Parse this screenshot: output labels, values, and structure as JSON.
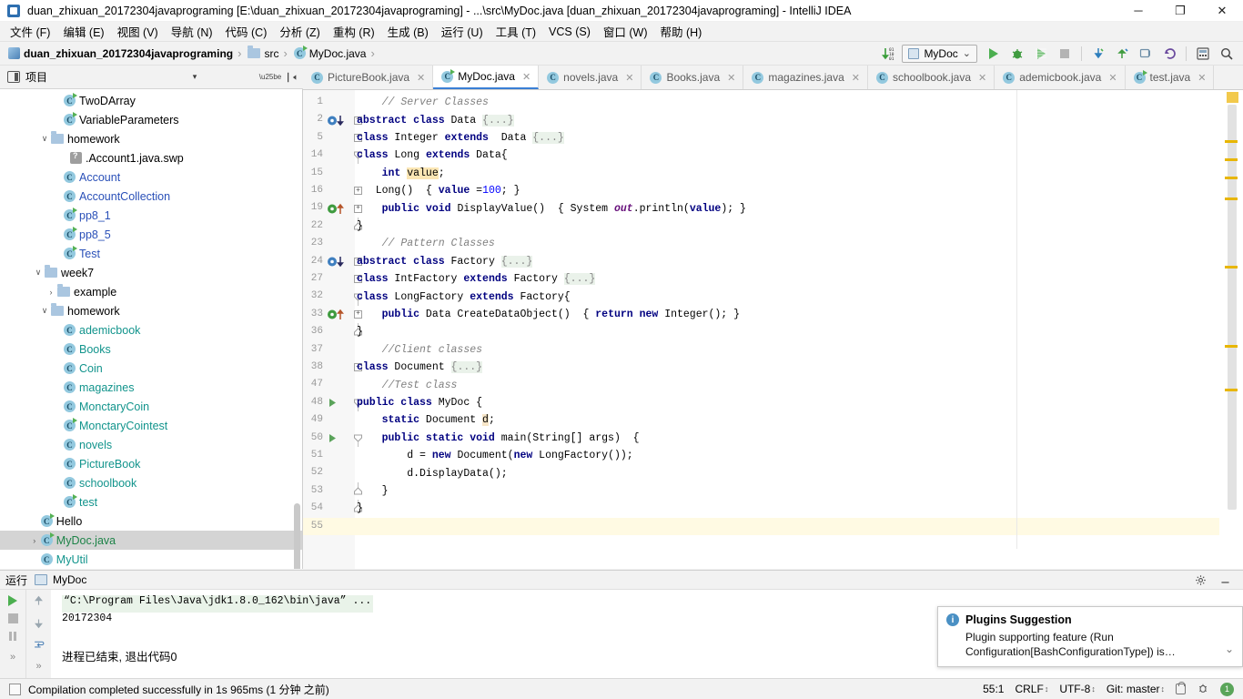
{
  "window": {
    "title": "duan_zhixuan_20172304javaprograming [E:\\duan_zhixuan_20172304javaprograming] - ...\\src\\MyDoc.java [duan_zhixuan_20172304javaprograming] - IntelliJ IDEA",
    "minimize": "─",
    "maximize": "❐",
    "close": "✕"
  },
  "menubar": {
    "items": [
      {
        "label": "文件 (F)"
      },
      {
        "label": "编辑 (E)"
      },
      {
        "label": "视图 (V)"
      },
      {
        "label": "导航 (N)"
      },
      {
        "label": "代码 (C)"
      },
      {
        "label": "分析 (Z)"
      },
      {
        "label": "重构 (R)"
      },
      {
        "label": "生成 (B)"
      },
      {
        "label": "运行 (U)"
      },
      {
        "label": "工具 (T)"
      },
      {
        "label": "VCS (S)"
      },
      {
        "label": "窗口 (W)"
      },
      {
        "label": "帮助 (H)"
      }
    ]
  },
  "breadcrumb": {
    "items": [
      {
        "label": "duan_zhixuan_20172304javaprograming",
        "icon": "module-icon",
        "bold": true
      },
      {
        "label": "src",
        "icon": "folder-icon",
        "bold": false
      },
      {
        "label": "MyDoc.java",
        "icon": "java-class-icon",
        "bold": false
      }
    ],
    "separator": "›"
  },
  "toolbar": {
    "sort_icon": "sort-numeric-icon",
    "run_config": "MyDoc",
    "run_config_caret": "⌄",
    "run_button": "run-button",
    "debug_button": "debug-button",
    "coverage_button": "run-with-coverage-button",
    "stop_button": "stop-button",
    "update_button": "vcs-update-button",
    "commit_button": "vcs-commit-button",
    "history_button": "vcs-history-button",
    "rollback_button": "vcs-rollback-button",
    "layout_button": "layout-button",
    "search_button": "search-everywhere-button"
  },
  "project_panel": {
    "title": "项目",
    "collapse_caret": "▾",
    "settings_icon": "gear-icon",
    "collapse_all_icon": "collapse-all-icon",
    "tree": [
      {
        "label": "TwoDArray",
        "indent": 4,
        "arrow": "",
        "icon": "java-class-runnable-icon",
        "color": "dark"
      },
      {
        "label": "VariableParameters",
        "indent": 4,
        "arrow": "",
        "icon": "java-class-runnable-icon",
        "color": "dark"
      },
      {
        "label": "homework",
        "indent": 3,
        "arrow": "∨",
        "icon": "folder-icon",
        "color": "dark"
      },
      {
        "label": ".Account1.java.swp",
        "indent": 4.5,
        "arrow": "",
        "icon": "unknown-file-icon",
        "color": "dark"
      },
      {
        "label": "Account",
        "indent": 4,
        "arrow": "",
        "icon": "java-class-icon",
        "color": "blue"
      },
      {
        "label": "AccountCollection",
        "indent": 4,
        "arrow": "",
        "icon": "java-class-icon",
        "color": "blue"
      },
      {
        "label": "pp8_1",
        "indent": 4,
        "arrow": "",
        "icon": "java-class-runnable-icon",
        "color": "blue"
      },
      {
        "label": "pp8_5",
        "indent": 4,
        "arrow": "",
        "icon": "java-class-runnable-icon",
        "color": "blue"
      },
      {
        "label": "Test",
        "indent": 4,
        "arrow": "",
        "icon": "java-class-runnable-icon",
        "color": "blue"
      },
      {
        "label": "week7",
        "indent": 2.5,
        "arrow": "∨",
        "icon": "folder-icon",
        "color": "dark"
      },
      {
        "label": "example",
        "indent": 3.5,
        "arrow": "›",
        "icon": "folder-icon",
        "color": "dark"
      },
      {
        "label": "homework",
        "indent": 3,
        "arrow": "∨",
        "icon": "folder-icon",
        "color": "dark"
      },
      {
        "label": "ademicbook",
        "indent": 4,
        "arrow": "",
        "icon": "java-class-icon",
        "color": "teal"
      },
      {
        "label": "Books",
        "indent": 4,
        "arrow": "",
        "icon": "java-class-icon",
        "color": "teal"
      },
      {
        "label": "Coin",
        "indent": 4,
        "arrow": "",
        "icon": "java-class-icon",
        "color": "teal"
      },
      {
        "label": "magazines",
        "indent": 4,
        "arrow": "",
        "icon": "java-class-icon",
        "color": "teal"
      },
      {
        "label": "MonctaryCoin",
        "indent": 4,
        "arrow": "",
        "icon": "java-class-icon",
        "color": "teal"
      },
      {
        "label": "MonctaryCointest",
        "indent": 4,
        "arrow": "",
        "icon": "java-class-runnable-icon",
        "color": "teal"
      },
      {
        "label": "novels",
        "indent": 4,
        "arrow": "",
        "icon": "java-class-icon",
        "color": "teal"
      },
      {
        "label": "PictureBook",
        "indent": 4,
        "arrow": "",
        "icon": "java-class-icon",
        "color": "teal"
      },
      {
        "label": "schoolbook",
        "indent": 4,
        "arrow": "",
        "icon": "java-class-icon",
        "color": "teal"
      },
      {
        "label": "test",
        "indent": 4,
        "arrow": "",
        "icon": "java-class-runnable-icon",
        "color": "teal"
      },
      {
        "label": "Hello",
        "indent": 2.2,
        "arrow": "",
        "icon": "java-class-runnable-icon",
        "color": "dark"
      },
      {
        "label": "MyDoc.java",
        "indent": 2.2,
        "arrow": "›",
        "icon": "java-class-runnable-icon",
        "color": "green",
        "selected": true
      },
      {
        "label": "MyUtil",
        "indent": 2.2,
        "arrow": "",
        "icon": "java-class-icon",
        "color": "teal"
      }
    ]
  },
  "editor_tabs": [
    {
      "label": "PictureBook.java",
      "active": false,
      "modified": false
    },
    {
      "label": "MyDoc.java",
      "active": true,
      "modified": true
    },
    {
      "label": "novels.java",
      "active": false,
      "modified": false
    },
    {
      "label": "Books.java",
      "active": false,
      "modified": false
    },
    {
      "label": "magazines.java",
      "active": false,
      "modified": false
    },
    {
      "label": "schoolbook.java",
      "active": false,
      "modified": false
    },
    {
      "label": "ademicbook.java",
      "active": false,
      "modified": false
    },
    {
      "label": "test.java",
      "active": false,
      "modified": true
    }
  ],
  "editor": {
    "lines": [
      {
        "num": "1",
        "gutter": "",
        "fold": "",
        "tokens": [
          {
            "t": "    ",
            "c": "id"
          },
          {
            "t": "// Server Classes",
            "c": "cm"
          }
        ]
      },
      {
        "num": "2",
        "gutter": "override-down",
        "fold": "plus",
        "tokens": [
          {
            "t": "abstract class ",
            "c": "kw"
          },
          {
            "t": "Data ",
            "c": "id"
          },
          {
            "t": "{...}",
            "c": "fldfold"
          }
        ]
      },
      {
        "num": "5",
        "gutter": "",
        "fold": "plus",
        "tokens": [
          {
            "t": "class ",
            "c": "kw"
          },
          {
            "t": "Integer ",
            "c": "id"
          },
          {
            "t": "extends ",
            "c": "kw"
          },
          {
            "t": " Data ",
            "c": "id"
          },
          {
            "t": "{...}",
            "c": "fldfold"
          }
        ]
      },
      {
        "num": "14",
        "gutter": "",
        "fold": "minus-top",
        "tokens": [
          {
            "t": "class ",
            "c": "kw"
          },
          {
            "t": "Long ",
            "c": "id"
          },
          {
            "t": "extends ",
            "c": "kw"
          },
          {
            "t": "Data{",
            "c": "id"
          }
        ]
      },
      {
        "num": "15",
        "gutter": "",
        "fold": "",
        "tokens": [
          {
            "t": "    ",
            "c": "id"
          },
          {
            "t": "int ",
            "c": "kw"
          },
          {
            "t": "value",
            "c": "hl"
          },
          {
            "t": ";",
            "c": "id"
          }
        ]
      },
      {
        "num": "16",
        "gutter": "",
        "fold": "plus",
        "tokens": [
          {
            "t": "   Long",
            "c": "id"
          },
          {
            "t": "()  { ",
            "c": "id"
          },
          {
            "t": "value ",
            "c": "kw"
          },
          {
            "t": "=",
            "c": "id"
          },
          {
            "t": "100",
            "c": "num"
          },
          {
            "t": "; }",
            "c": "id"
          }
        ]
      },
      {
        "num": "19",
        "gutter": "implement-up",
        "fold": "plus",
        "tokens": [
          {
            "t": "    ",
            "c": "id"
          },
          {
            "t": "public void ",
            "c": "kw"
          },
          {
            "t": "DisplayValue()  { System ",
            "c": "id"
          },
          {
            "t": "out",
            "c": "stat"
          },
          {
            "t": ".println(",
            "c": "id"
          },
          {
            "t": "value",
            "c": "kw"
          },
          {
            "t": "); }",
            "c": "id"
          }
        ]
      },
      {
        "num": "22",
        "gutter": "",
        "fold": "minus-bot",
        "tokens": [
          {
            "t": "}",
            "c": "id"
          }
        ]
      },
      {
        "num": "23",
        "gutter": "",
        "fold": "",
        "tokens": [
          {
            "t": "    ",
            "c": "id"
          },
          {
            "t": "// Pattern Classes",
            "c": "cm"
          }
        ]
      },
      {
        "num": "24",
        "gutter": "override-down",
        "fold": "plus",
        "tokens": [
          {
            "t": "abstract class ",
            "c": "kw"
          },
          {
            "t": "Factory ",
            "c": "id"
          },
          {
            "t": "{...}",
            "c": "fldfold"
          }
        ]
      },
      {
        "num": "27",
        "gutter": "",
        "fold": "plus",
        "tokens": [
          {
            "t": "class ",
            "c": "kw"
          },
          {
            "t": "IntFactory ",
            "c": "id"
          },
          {
            "t": "extends ",
            "c": "kw"
          },
          {
            "t": "Factory ",
            "c": "id"
          },
          {
            "t": "{...}",
            "c": "fldfold"
          }
        ]
      },
      {
        "num": "32",
        "gutter": "",
        "fold": "minus-top",
        "tokens": [
          {
            "t": "class ",
            "c": "kw"
          },
          {
            "t": "LongFactory ",
            "c": "id"
          },
          {
            "t": "extends ",
            "c": "kw"
          },
          {
            "t": "Factory{",
            "c": "id"
          }
        ]
      },
      {
        "num": "33",
        "gutter": "implement-up",
        "fold": "plus",
        "tokens": [
          {
            "t": "    ",
            "c": "id"
          },
          {
            "t": "public ",
            "c": "kw"
          },
          {
            "t": "Data CreateDataObject()  { ",
            "c": "id"
          },
          {
            "t": "return new ",
            "c": "kw"
          },
          {
            "t": "Integer(); }",
            "c": "id"
          }
        ]
      },
      {
        "num": "36",
        "gutter": "",
        "fold": "minus-bot",
        "tokens": [
          {
            "t": "}",
            "c": "id"
          }
        ]
      },
      {
        "num": "37",
        "gutter": "",
        "fold": "",
        "tokens": [
          {
            "t": "    ",
            "c": "id"
          },
          {
            "t": "//Client classes",
            "c": "cm"
          }
        ]
      },
      {
        "num": "38",
        "gutter": "",
        "fold": "plus",
        "tokens": [
          {
            "t": "class ",
            "c": "kw"
          },
          {
            "t": "Document ",
            "c": "id"
          },
          {
            "t": "{...}",
            "c": "fldfold"
          }
        ]
      },
      {
        "num": "47",
        "gutter": "",
        "fold": "",
        "tokens": [
          {
            "t": "    ",
            "c": "id"
          },
          {
            "t": "//Test class",
            "c": "cm"
          }
        ]
      },
      {
        "num": "48",
        "gutter": "run-triangle",
        "fold": "minus-top",
        "tokens": [
          {
            "t": "public class ",
            "c": "kw"
          },
          {
            "t": "MyDoc {",
            "c": "id"
          }
        ]
      },
      {
        "num": "49",
        "gutter": "",
        "fold": "",
        "tokens": [
          {
            "t": "    ",
            "c": "id"
          },
          {
            "t": "static ",
            "c": "kw"
          },
          {
            "t": "Document ",
            "c": "id"
          },
          {
            "t": "d",
            "c": "fieldhl"
          },
          {
            "t": ";",
            "c": "id"
          }
        ]
      },
      {
        "num": "50",
        "gutter": "run-triangle",
        "fold": "minus-top",
        "tokens": [
          {
            "t": "    ",
            "c": "id"
          },
          {
            "t": "public static void ",
            "c": "kw"
          },
          {
            "t": "main(String[] args)  {",
            "c": "id"
          }
        ]
      },
      {
        "num": "51",
        "gutter": "",
        "fold": "",
        "tokens": [
          {
            "t": "        d = ",
            "c": "id"
          },
          {
            "t": "new ",
            "c": "kw"
          },
          {
            "t": "Document(",
            "c": "id"
          },
          {
            "t": "new ",
            "c": "kw"
          },
          {
            "t": "LongFactory());",
            "c": "id"
          }
        ]
      },
      {
        "num": "52",
        "gutter": "",
        "fold": "",
        "tokens": [
          {
            "t": "        d.DisplayData();",
            "c": "id"
          }
        ]
      },
      {
        "num": "53",
        "gutter": "",
        "fold": "minus-bot",
        "tokens": [
          {
            "t": "    }",
            "c": "id"
          }
        ]
      },
      {
        "num": "54",
        "gutter": "",
        "fold": "minus-bot",
        "tokens": [
          {
            "t": "}",
            "c": "id"
          }
        ]
      },
      {
        "num": "55",
        "gutter": "",
        "fold": "",
        "tokens": [
          {
            "t": " ",
            "c": "id"
          }
        ],
        "current": true
      }
    ]
  },
  "run_panel": {
    "title": "运行",
    "tab_label": "MyDoc",
    "settings_icon": "gear-icon",
    "minimize_icon": "minimize-icon",
    "tools": [
      "rerun-button",
      "stop-button",
      "pause-button",
      "more-button"
    ],
    "tools2": [
      "scroll-up-button",
      "scroll-down-button",
      "soft-wrap-button",
      "more-button"
    ],
    "console": [
      {
        "text": "“C:\\Program Files\\Java\\jdk1.8.0_162\\bin\\java” ...",
        "style": "cmd"
      },
      {
        "text": "20172304",
        "style": "plain"
      },
      {
        "text": "",
        "style": "plain"
      },
      {
        "text": "进程已结束, 退出代码0",
        "style": "zh"
      }
    ]
  },
  "notification": {
    "icon": "info-icon",
    "title": "Plugins Suggestion",
    "body": "Plugin supporting feature (Run Configuration[BashConfigurationType]) is…",
    "chevron": "⌄"
  },
  "statusbar": {
    "icon": "build-icon",
    "message": "Compilation completed successfully in 1s 965ms (1 分钟 之前)",
    "caret_position": "55:1",
    "line_separator": "CRLF",
    "encoding": "UTF-8",
    "branch": "Git: master",
    "caret_glyph": "↕",
    "lock_icon": "lock-icon",
    "inspection_icon": "inspection-icon",
    "notification_count": "1"
  },
  "colors": {
    "accent": "#3a7fd5",
    "keyword": "#000080",
    "comment": "#808080",
    "number": "#0000ff",
    "tree_blue": "#2a50b8",
    "tree_teal": "#12948c",
    "tree_green": "#1d8348",
    "warn_marker": "#e8b600",
    "run_green": "#4caf50"
  }
}
